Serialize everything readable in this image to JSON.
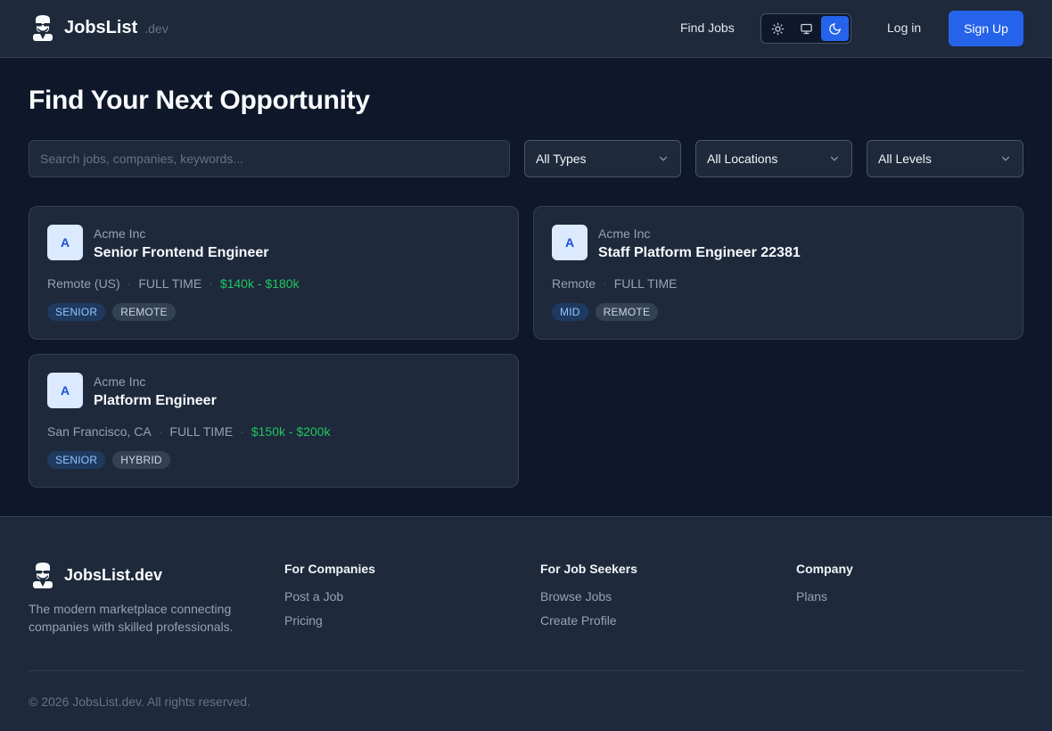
{
  "header": {
    "brand": "JobsList",
    "brand_suffix": ".dev",
    "nav_find_jobs": "Find Jobs",
    "theme_options": [
      "sun-icon",
      "monitor-icon",
      "moon-icon"
    ],
    "theme_active": "dark",
    "login": "Log in",
    "signup": "Sign Up"
  },
  "main": {
    "title": "Find Your Next Opportunity",
    "search_placeholder": "Search jobs, companies, keywords...",
    "filters": {
      "type": "All Types",
      "location": "All Locations",
      "level": "All Levels"
    },
    "jobs": [
      {
        "avatar": "A",
        "company": "Acme Inc",
        "title": "Senior Frontend Engineer",
        "location": "Remote (US)",
        "employment": "FULL TIME",
        "salary": "$140k - $180k",
        "level": "SENIOR",
        "work_mode": "REMOTE"
      },
      {
        "avatar": "A",
        "company": "Acme Inc",
        "title": "Staff Platform Engineer 22381",
        "location": "Remote",
        "employment": "FULL TIME",
        "salary": "",
        "level": "MID",
        "work_mode": "REMOTE"
      },
      {
        "avatar": "A",
        "company": "Acme Inc",
        "title": "Platform Engineer",
        "location": "San Francisco, CA",
        "employment": "FULL TIME",
        "salary": "$150k - $200k",
        "level": "SENIOR",
        "work_mode": "HYBRID"
      }
    ]
  },
  "footer": {
    "brand": "JobsList.dev",
    "description": "The modern marketplace connecting companies with skilled professionals.",
    "columns": [
      {
        "heading": "For Companies",
        "links": [
          "Post a Job",
          "Pricing"
        ]
      },
      {
        "heading": "For Job Seekers",
        "links": [
          "Browse Jobs",
          "Create Profile"
        ]
      },
      {
        "heading": "Company",
        "links": [
          "Plans"
        ]
      }
    ],
    "copyright": "© 2026 JobsList.dev. All rights reserved."
  },
  "colors": {
    "background": "#0f172a",
    "surface": "#1e293b",
    "accent": "#2563eb",
    "salary": "#22c55e"
  }
}
